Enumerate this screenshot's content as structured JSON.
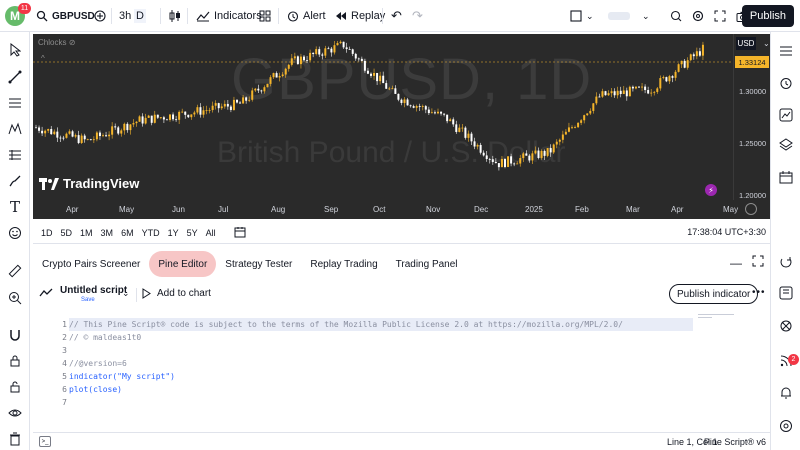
{
  "topbar": {
    "avatar_letter": "M",
    "avatar_badge": "11",
    "symbol": "GBPUSD",
    "interval": "3h",
    "interval_extra": "D",
    "indicators_label": "Indicators",
    "alert_label": "Alert",
    "replay_label": "Replay",
    "publish_label": "Publish"
  },
  "chart": {
    "watermark_symbol": "GBPUSD, 1D",
    "watermark_name": "British Pound / U.S. Dollar",
    "logo_text": "TradingView",
    "currency": "USD",
    "current_price": "1.33124",
    "price_ticks": [
      "1.30000",
      "1.25000",
      "1.20000"
    ],
    "time_ticks": [
      "Apr",
      "May",
      "Jun",
      "Jul",
      "Aug",
      "Sep",
      "Oct",
      "Nov",
      "Dec",
      "2025",
      "Feb",
      "Mar",
      "Apr",
      "May"
    ],
    "candle_color_up": "#f5b52a",
    "candle_color_down": "#ffffff",
    "indicator_text": "Chlocks"
  },
  "chart_data": {
    "type": "line",
    "title": "GBPUSD, 1D",
    "x": [
      "Apr",
      "May",
      "Jun",
      "Jul",
      "Aug",
      "Sep",
      "Oct",
      "Nov",
      "Dec",
      "2025",
      "Feb",
      "Mar",
      "Apr",
      "May"
    ],
    "values": [
      1.262,
      1.25,
      1.268,
      1.275,
      1.283,
      1.32,
      1.335,
      1.29,
      1.27,
      1.23,
      1.24,
      1.29,
      1.296,
      1.331
    ],
    "ylim": [
      1.19,
      1.35
    ]
  },
  "timebar": {
    "ranges": [
      "1D",
      "5D",
      "1M",
      "3M",
      "6M",
      "YTD",
      "1Y",
      "5Y",
      "All"
    ],
    "clock": "17:38:04 UTC+3:30"
  },
  "bottom_tabs": [
    "Crypto Pairs Screener",
    "Pine Editor",
    "Strategy Tester",
    "Replay Trading",
    "Trading Panel"
  ],
  "editor": {
    "script_name": "Untitled script",
    "save_label": "Save",
    "add_to_chart": "Add to chart",
    "publish_indicator": "Publish indicator"
  },
  "code_lines": [
    "// This Pine Script® code is subject to the terms of the Mozilla Public License 2.0 at https://mozilla.org/MPL/2.0/",
    "// © maldeas1t0",
    "",
    "//@version=6",
    "indicator(\"My script\")",
    "plot(close)",
    ""
  ],
  "statusbar": {
    "position": "Line 1, Col 1",
    "language": "Pine Script® v6"
  },
  "right_badge": "2"
}
